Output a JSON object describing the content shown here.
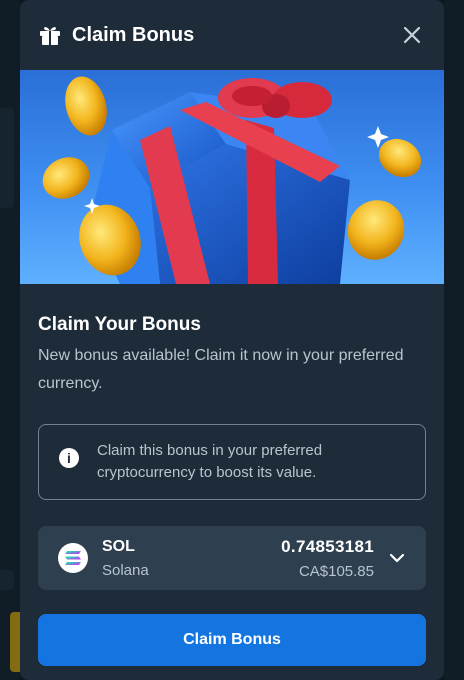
{
  "modal": {
    "title": "Claim Bonus",
    "header_icon": "gift-icon",
    "close_icon": "close-icon"
  },
  "banner": {
    "image": "gift-box-with-coins-illustration"
  },
  "content": {
    "heading": "Claim Your Bonus",
    "description": "New bonus available! Claim it now in your preferred currency."
  },
  "info": {
    "icon": "info-icon",
    "text": "Claim this bonus in your preferred cryptocurrency to boost its value."
  },
  "currency": {
    "code": "SOL",
    "name": "Solana",
    "amount": "0.74853181",
    "fiat_value": "CA$105.85",
    "icon": "solana-logo-icon",
    "dropdown_icon": "chevron-down-icon"
  },
  "actions": {
    "claim_label": "Claim Bonus"
  },
  "colors": {
    "modal_bg": "#1e2c39",
    "select_bg": "#2e3f4f",
    "primary": "#1475e1",
    "text_secondary": "#b8c4d0"
  }
}
